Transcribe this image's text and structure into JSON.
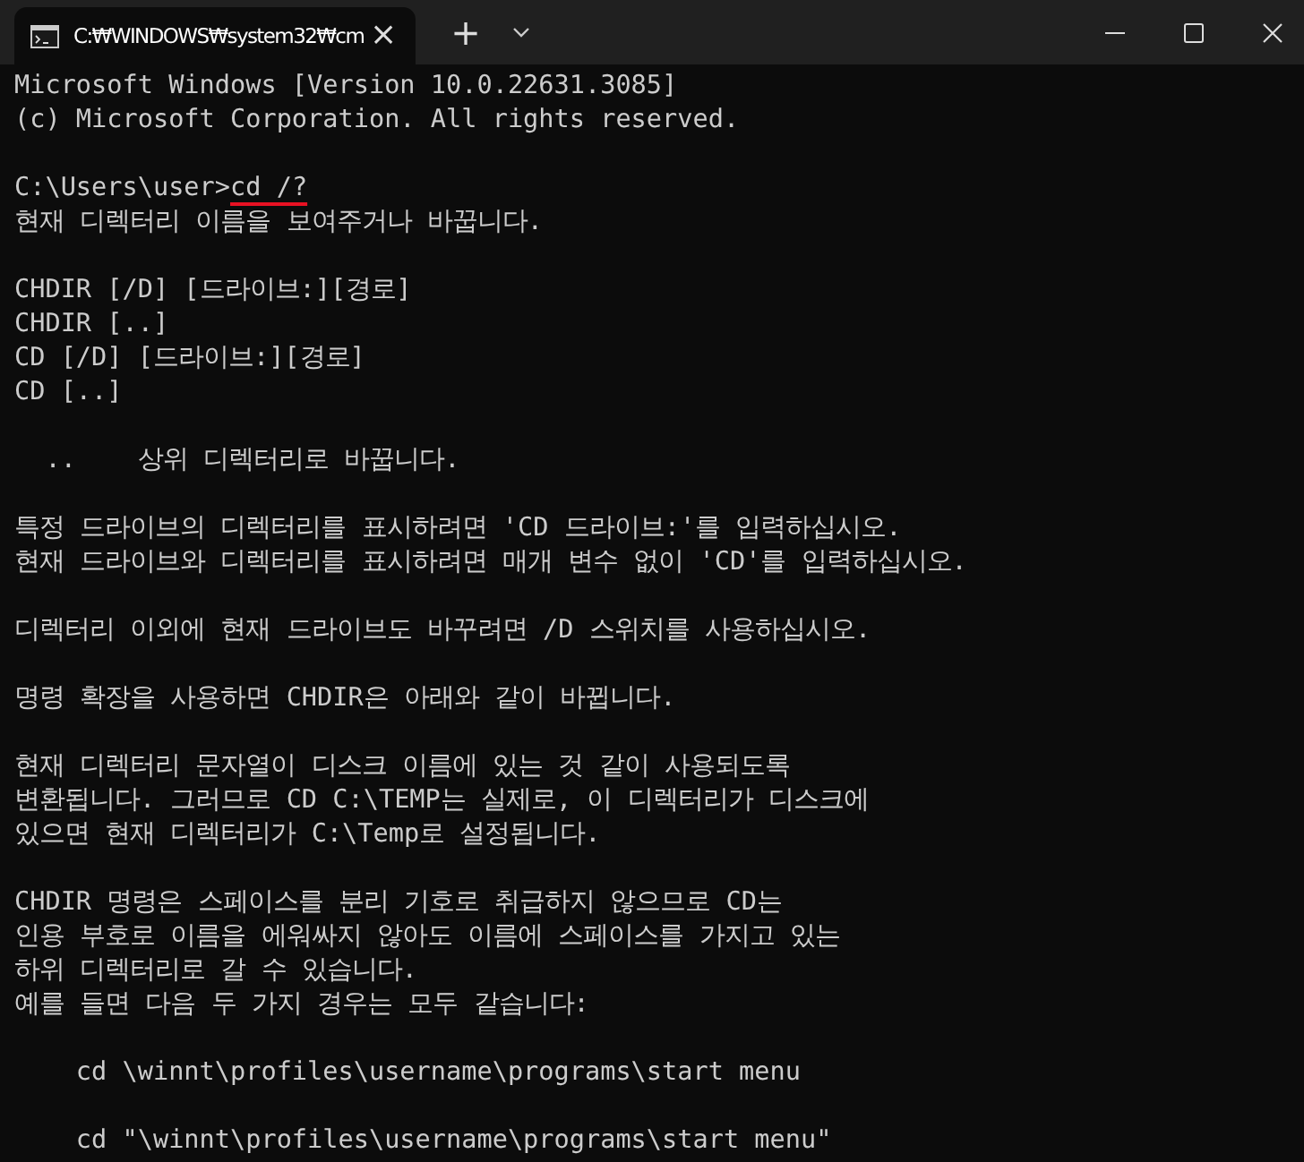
{
  "window": {
    "tab_title": "C:₩WINDOWS₩system32₩cm",
    "tab_close": "×",
    "new_tab": "+"
  },
  "terminal": {
    "header": [
      "Microsoft Windows [Version 10.0.22631.3085]",
      "(c) Microsoft Corporation. All rights reserved."
    ],
    "prompt": {
      "path": "C:\\Users\\user>",
      "command": "cd /?"
    },
    "blocks": [
      [
        "현재 디렉터리 이름을 보여주거나 바꿉니다."
      ],
      [
        "CHDIR [/D] [드라이브:][경로]",
        "CHDIR [..]",
        "CD [/D] [드라이브:][경로]",
        "CD [..]"
      ],
      [
        "  ..    상위 디렉터리로 바꿉니다."
      ],
      [
        "특정 드라이브의 디렉터리를 표시하려면 'CD 드라이브:'를 입력하십시오.",
        "현재 드라이브와 디렉터리를 표시하려면 매개 변수 없이 'CD'를 입력하십시오."
      ],
      [
        "디렉터리 이외에 현재 드라이브도 바꾸려면 /D 스위치를 사용하십시오."
      ],
      [
        "명령 확장을 사용하면 CHDIR은 아래와 같이 바뀝니다."
      ],
      [
        "현재 디렉터리 문자열이 디스크 이름에 있는 것 같이 사용되도록",
        "변환됩니다. 그러므로 CD C:\\TEMP는 실제로, 이 디렉터리가 디스크에",
        "있으면 현재 디렉터리가 C:\\Temp로 설정됩니다."
      ],
      [
        "CHDIR 명령은 스페이스를 분리 기호로 취급하지 않으므로 CD는",
        "인용 부호로 이름을 에워싸지 않아도 이름에 스페이스를 가지고 있는",
        "하위 디렉터리로 갈 수 있습니다.",
        "예를 들면 다음 두 가지 경우는 모두 같습니다:"
      ],
      [
        "    cd \\winnt\\profiles\\username\\programs\\start menu"
      ],
      [
        "    cd \"\\winnt\\profiles\\username\\programs\\start menu\""
      ]
    ]
  }
}
